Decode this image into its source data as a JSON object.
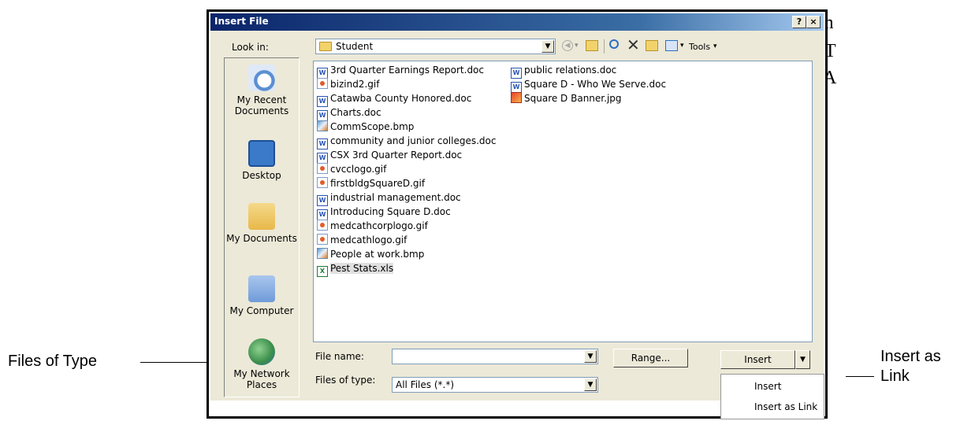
{
  "dialog": {
    "title": "Insert File",
    "help_button": "?",
    "close_button": "×"
  },
  "lookin": {
    "label": "Look in:",
    "value": "Student"
  },
  "toolbar": {
    "tools_label": "Tools"
  },
  "places": [
    {
      "label": "My Recent Documents",
      "icon": "recent-documents-icon",
      "color": "#5b8fd1"
    },
    {
      "label": "Desktop",
      "icon": "desktop-icon",
      "color": "#3b79c9"
    },
    {
      "label": "My Documents",
      "icon": "my-documents-icon",
      "color": "#e8b84a"
    },
    {
      "label": "My Computer",
      "icon": "my-computer-icon",
      "color": "#6f9bd8"
    },
    {
      "label": "My Network Places",
      "icon": "network-places-icon",
      "color": "#3a8d4a"
    }
  ],
  "files_col1": [
    {
      "name": "3rd Quarter Earnings Report.doc",
      "type": "doc"
    },
    {
      "name": "bizind2.gif",
      "type": "gif"
    },
    {
      "name": "Catawba County Honored.doc",
      "type": "doc"
    },
    {
      "name": "Charts.doc",
      "type": "doc"
    },
    {
      "name": "CommScope.bmp",
      "type": "bmp"
    },
    {
      "name": "community and junior colleges.doc",
      "type": "doc"
    },
    {
      "name": "CSX 3rd Quarter Report.doc",
      "type": "doc"
    },
    {
      "name": "cvcclogo.gif",
      "type": "gif"
    },
    {
      "name": "firstbldgSquareD.gif",
      "type": "gif"
    },
    {
      "name": "industrial management.doc",
      "type": "doc"
    },
    {
      "name": "Introducing Square D.doc",
      "type": "doc"
    },
    {
      "name": "medcathcorplogo.gif",
      "type": "gif"
    },
    {
      "name": "medcathlogo.gif",
      "type": "gif"
    },
    {
      "name": "People at work.bmp",
      "type": "bmp"
    },
    {
      "name": "Pest Stats.xls",
      "type": "xls"
    }
  ],
  "files_col2": [
    {
      "name": "public relations.doc",
      "type": "doc"
    },
    {
      "name": "Square D - Who We Serve.doc",
      "type": "doc"
    },
    {
      "name": "Square D Banner.jpg",
      "type": "jpg"
    }
  ],
  "filename": {
    "label": "File name:",
    "value": ""
  },
  "filetype": {
    "label": "Files of type:",
    "value": "All Files (*.*)"
  },
  "buttons": {
    "range": "Range...",
    "insert": "Insert"
  },
  "insert_menu": {
    "items": [
      "Insert",
      "Insert as Link"
    ]
  },
  "callouts": {
    "files_of_type": "Files of Type",
    "insert_as_link_line1": "Insert as",
    "insert_as_link_line2": "Link"
  },
  "background_text": {
    "line1": "m",
    "line2": "T",
    "line3": "A"
  }
}
